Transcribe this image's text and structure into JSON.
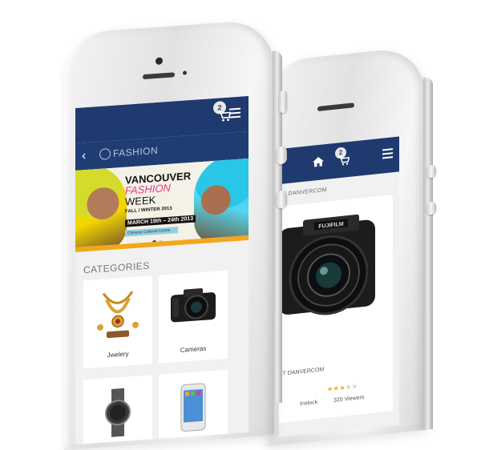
{
  "front": {
    "cart_count": "2",
    "brand": "FASHION",
    "banner": {
      "line1": "VANCOUVER",
      "line2": "FASHION",
      "line3": "WEEK",
      "season": "FALL / WINTER 2013",
      "dates": "MARCH 19th – 24th 2013",
      "venue": "Chinese Cultural Centre",
      "slide_index": 1,
      "slide_count": 2
    },
    "categories_heading": "CATEGORIES",
    "categories": [
      {
        "label": "Jwelery",
        "icon": "necklace-icon"
      },
      {
        "label": "Cameras",
        "icon": "camera-icon"
      },
      {
        "label": "",
        "icon": "watch-icon"
      },
      {
        "label": "",
        "icon": "smartphone-icon"
      }
    ]
  },
  "back": {
    "cart_count": "2",
    "title": "ET DANVERCOM",
    "product_sub": "ET DANVERCOM",
    "rating": 3,
    "rating_max": 5,
    "stock": "Instock",
    "views": "320 Viewers"
  },
  "colors": {
    "navy": "#1f3a6e",
    "accent_orange": "#f3a71b",
    "badge": "#e7e7e7"
  }
}
